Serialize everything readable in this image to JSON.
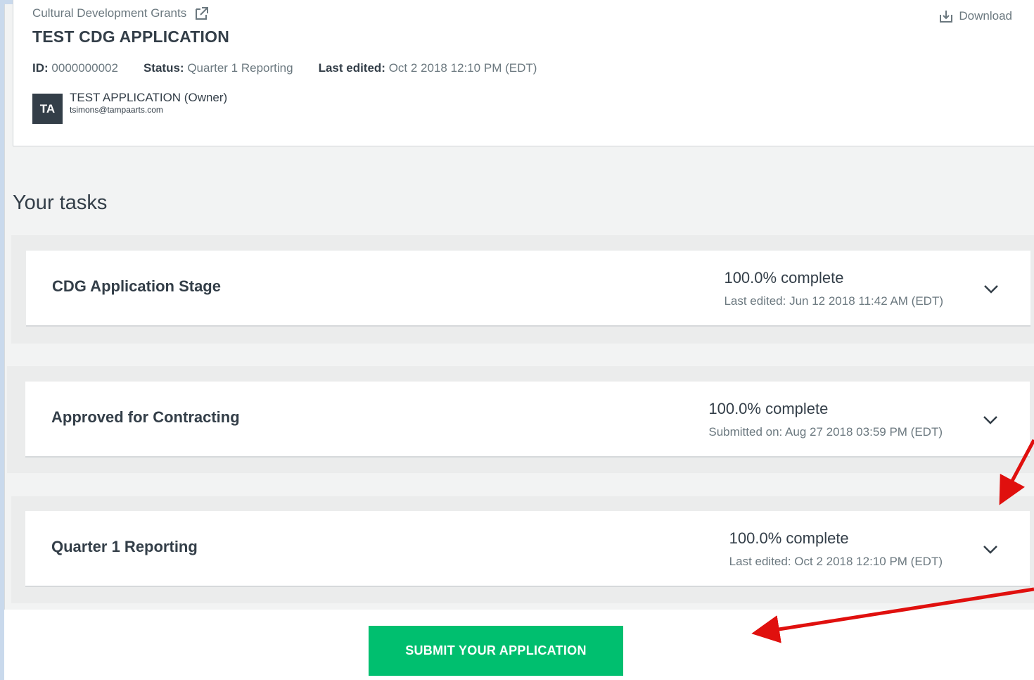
{
  "header": {
    "program_link": "Cultural Development Grants",
    "application_title": "TEST CDG APPLICATION",
    "download_label": "Download",
    "id_label": "ID:",
    "id_value": "0000000002",
    "status_label": "Status:",
    "status_value": "Quarter 1 Reporting",
    "last_edited_label": "Last edited:",
    "last_edited_value": "Oct 2 2018 12:10 PM (EDT)",
    "owner": {
      "initials": "TA",
      "name": "TEST APPLICATION (Owner)",
      "email": "tsimons@tampaarts.com"
    }
  },
  "tasks_heading": "Your tasks",
  "tasks": [
    {
      "name": "CDG Application Stage",
      "progress": "100.0% complete",
      "date_text": "Last edited: Jun 12 2018 11:42 AM (EDT)"
    },
    {
      "name": "Approved for Contracting",
      "progress": "100.0% complete",
      "date_text": "Submitted on: Aug 27 2018 03:59 PM (EDT)"
    },
    {
      "name": "Quarter 1 Reporting",
      "progress": "100.0% complete",
      "date_text": "Last edited: Oct 2 2018 12:10 PM (EDT)"
    }
  ],
  "submit_button": "SUBMIT YOUR APPLICATION",
  "colors": {
    "accent_green": "#00bf6f",
    "annotation_red": "#e0100e",
    "text_dark": "#333e48"
  }
}
